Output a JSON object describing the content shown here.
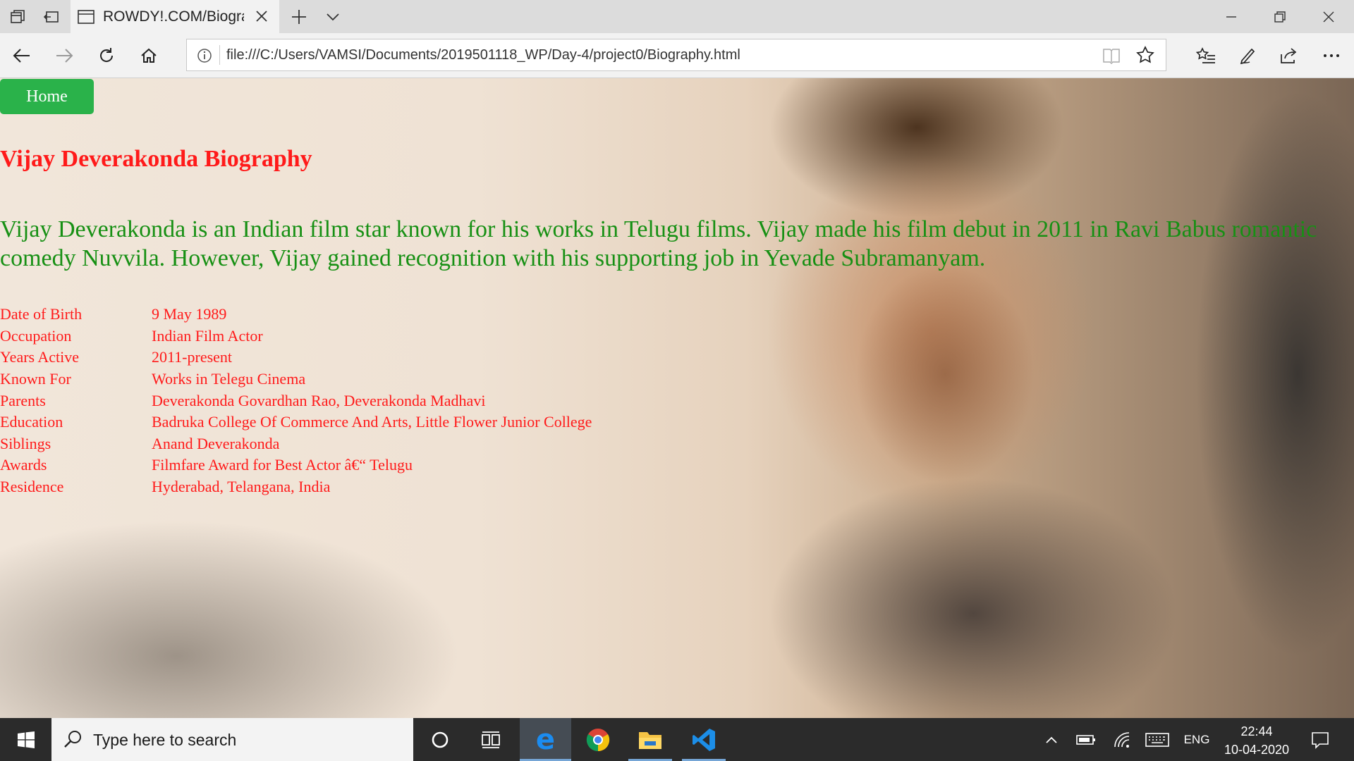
{
  "browser": {
    "tab_title": "ROWDY!.COM/Biography",
    "url": "file:///C:/Users/VAMSI/Documents/2019501118_WP/Day-4/project0/Biography.html",
    "icons": [
      "tab-manager-icon",
      "back-tabs-icon",
      "page-icon",
      "close-icon",
      "new-tab-icon",
      "chevron-down-icon",
      "minimize-icon",
      "restore-icon",
      "window-close-icon",
      "back-arrow-icon",
      "forward-arrow-icon",
      "refresh-icon",
      "home-icon",
      "info-icon",
      "reading-view-icon",
      "favorite-star-icon",
      "favorites-list-icon",
      "pen-icon",
      "share-icon",
      "more-icon"
    ]
  },
  "page": {
    "home_button": "Home",
    "title": "Vijay Deverakonda Biography",
    "paragraph": "Vijay Deverakonda is an Indian film star known for his works in Telugu films. Vijay made his film debut in 2011 in Ravi Babus romantic comedy Nuvvila. However, Vijay gained recognition with his supporting job in Yevade Subramanyam.",
    "facts": [
      {
        "label": "Date of Birth",
        "value": "9 May 1989"
      },
      {
        "label": "Occupation",
        "value": "Indian Film Actor"
      },
      {
        "label": "Years Active",
        "value": "2011-present"
      },
      {
        "label": "Known For",
        "value": "Works in Telegu Cinema"
      },
      {
        "label": "Parents",
        "value": "Deverakonda Govardhan Rao, Deverakonda Madhavi"
      },
      {
        "label": "Education",
        "value": "Badruka College Of Commerce And Arts, Little Flower Junior College"
      },
      {
        "label": "Siblings",
        "value": "Anand Deverakonda"
      },
      {
        "label": "Awards",
        "value": "Filmfare Award for Best Actor â€“ Telugu"
      },
      {
        "label": "Residence",
        "value": "Hyderabad, Telangana, India"
      }
    ],
    "colors": {
      "title": "#ff1a1a",
      "paragraph": "#179014",
      "home_button": "#2ab24a"
    }
  },
  "taskbar": {
    "search_placeholder": "Type here to search",
    "language": "ENG",
    "time": "22:44",
    "date": "10-04-2020",
    "apps": [
      "cortana-icon",
      "task-view-icon",
      "edge-icon",
      "chrome-icon",
      "file-explorer-icon",
      "vscode-icon"
    ]
  }
}
